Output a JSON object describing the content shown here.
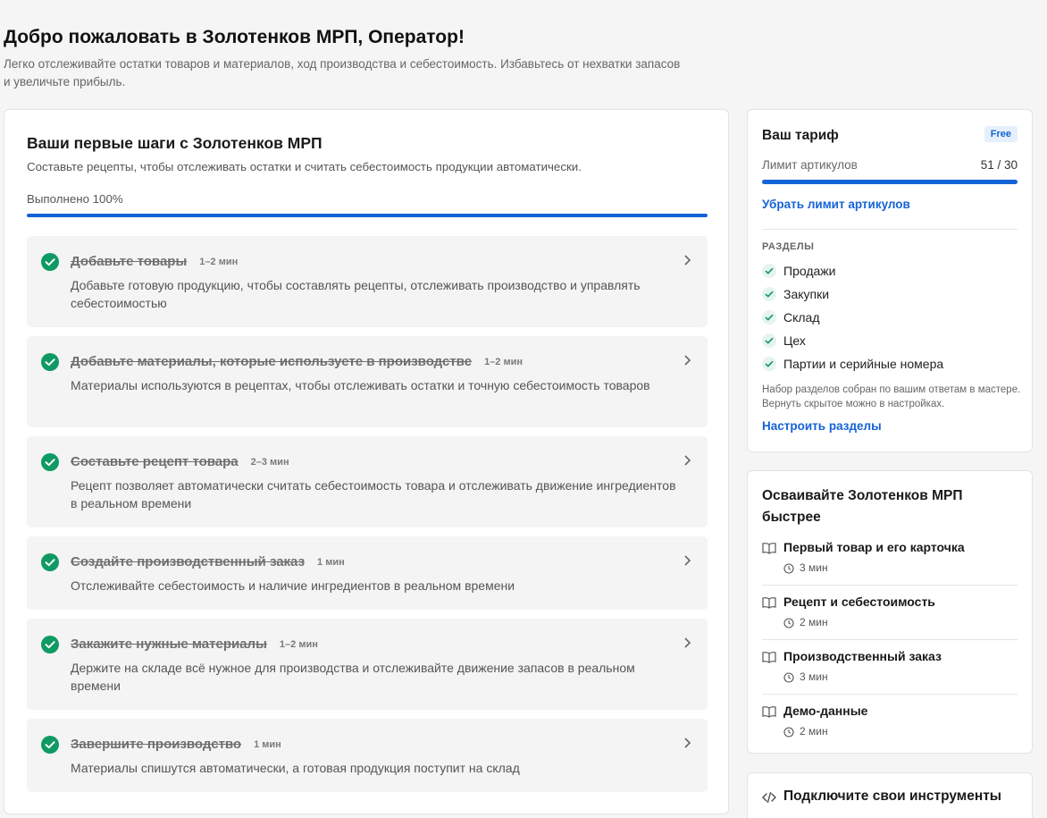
{
  "header": {
    "title": "Добро пожаловать в Золотенков МРП, Оператор!",
    "subtitle": "Легко отслеживайте остатки товаров и материалов, ход производства и себестоимость. Избавьтесь от нехватки запасов и увеличьте прибыль."
  },
  "onboarding": {
    "title": "Ваши первые шаги с Золотенков МРП",
    "description": "Составьте рецепты, чтобы отслеживать остатки и считать себестоимость продукции автоматически.",
    "progress_label": "Выполнено 100%",
    "progress_percent": 100,
    "steps": [
      {
        "title": "Добавьте товары",
        "time": "1–2 мин",
        "text": "Добавьте готовую продукцию, чтобы составлять рецепты, отслеживать производство и управлять себестоимостью",
        "done": true
      },
      {
        "title": "Добавьте материалы, которые используете в производстве",
        "time": "1–2 мин",
        "text": "Материалы используются в рецептах, чтобы отслеживать остатки и точную себестоимость товаров",
        "done": true
      },
      {
        "title": "Составьте рецепт товара",
        "time": "2–3 мин",
        "text": "Рецепт позволяет автоматически считать себестоимость товара и отслеживать движение ингредиентов в реальном времени",
        "done": true
      },
      {
        "title": "Создайте производственный заказ",
        "time": "1 мин",
        "text": "Отслеживайте себестоимость и наличие ингредиентов в реальном времени",
        "done": true
      },
      {
        "title": "Закажите нужные материалы",
        "time": "1–2 мин",
        "text": "Держите на складе всё нужное для производства и отслеживайте движение запасов в реальном времени",
        "done": true
      },
      {
        "title": "Завершите производство",
        "time": "1 мин",
        "text": "Материалы спишутся автоматически, а готовая продукция поступит на склад",
        "done": true
      }
    ]
  },
  "plan": {
    "title": "Ваш тариф",
    "badge": "Free",
    "limit_label": "Лимит артикулов",
    "limit_value": "51 / 30",
    "limit_fill": 1.0,
    "remove_limit_link": "Убрать лимит артикулов",
    "sections_heading": "РАЗДЕЛЫ",
    "sections": [
      "Продажи",
      "Закупки",
      "Склад",
      "Цех",
      "Партии и серийные номера"
    ],
    "sections_note": "Набор разделов собран по вашим ответам в мастере. Вернуть скрытое можно в настройках.",
    "configure_link": "Настроить разделы"
  },
  "learn": {
    "title": "Осваивайте Золотенков МРП быстрее",
    "lessons": [
      {
        "title": "Первый товар и его карточка",
        "duration": "3 мин"
      },
      {
        "title": "Рецепт и себестоимость",
        "duration": "2 мин"
      },
      {
        "title": "Производственный заказ",
        "duration": "3 мин"
      },
      {
        "title": "Демо-данные",
        "duration": "2 мин"
      }
    ]
  },
  "tools": {
    "title": "Подключите свои инструменты"
  },
  "colors": {
    "accent": "#1463d6",
    "success": "#0f9a63",
    "background": "#f5f5f5"
  }
}
